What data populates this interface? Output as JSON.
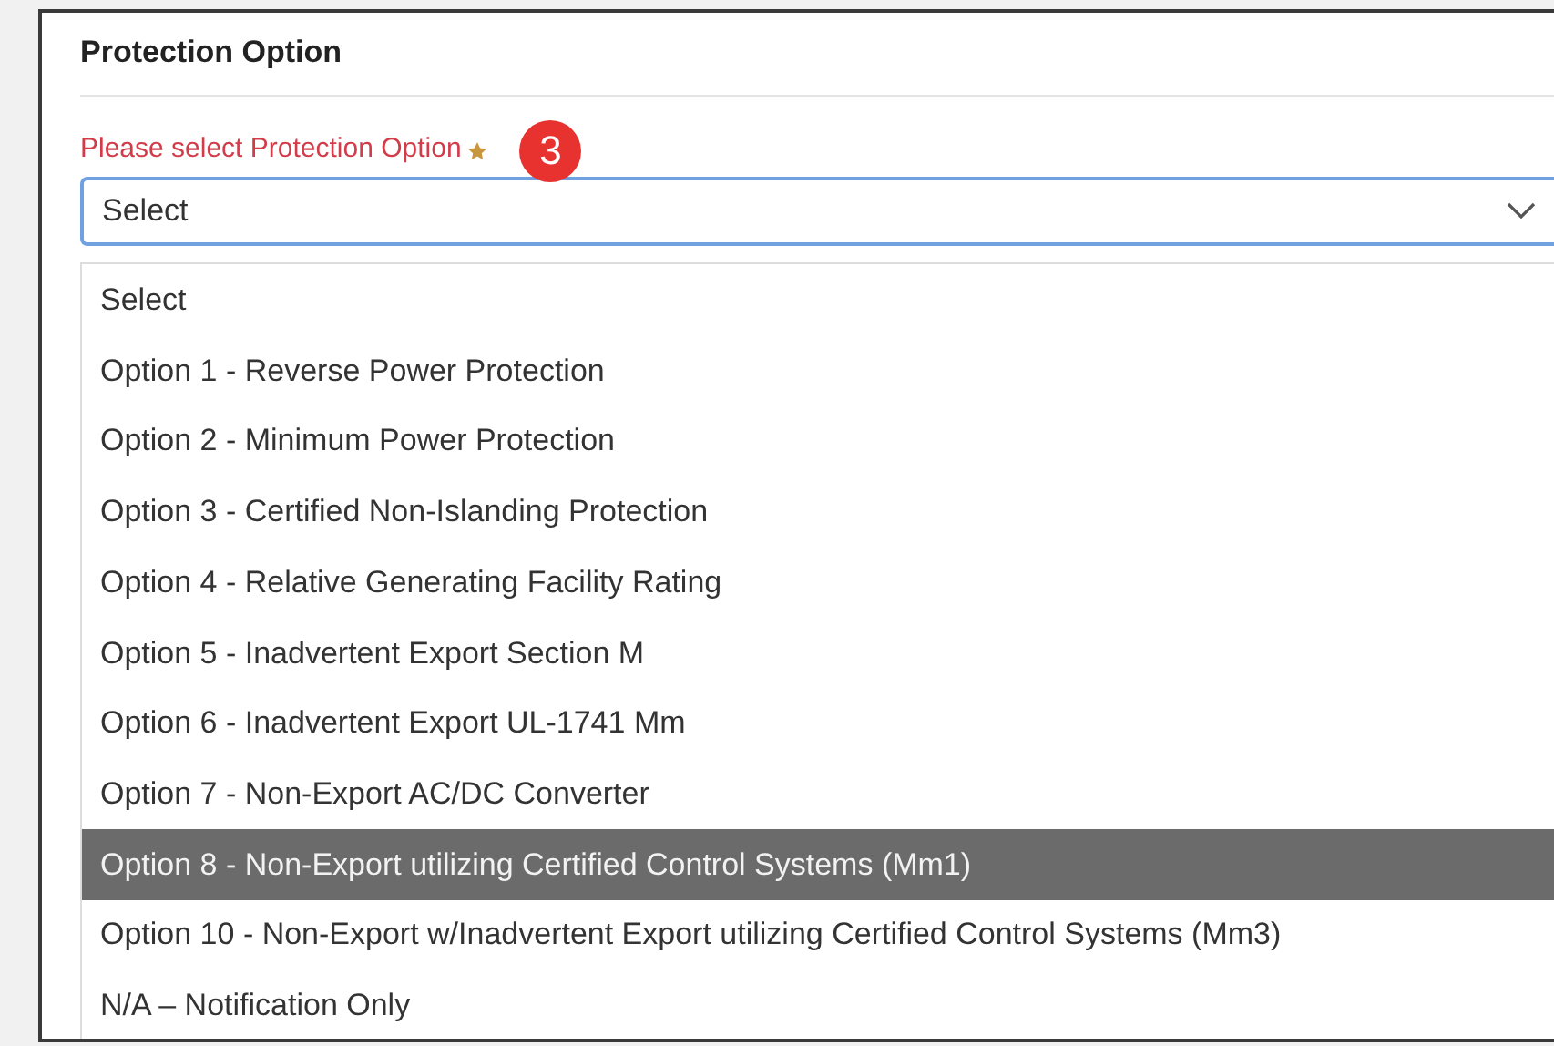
{
  "section": {
    "title": "Protection Option"
  },
  "field": {
    "label": "Please select Protection Option",
    "required": true,
    "step_badge": "3",
    "value": "Select",
    "expanded": true
  },
  "options": [
    {
      "label": "Select",
      "selected": false
    },
    {
      "label": "Option 1 - Reverse Power Protection",
      "selected": false
    },
    {
      "label": "Option 2 - Minimum Power Protection",
      "selected": false
    },
    {
      "label": "Option 3 - Certified Non-Islanding Protection",
      "selected": false
    },
    {
      "label": "Option 4 - Relative Generating Facility Rating",
      "selected": false
    },
    {
      "label": "Option 5 - Inadvertent Export Section M",
      "selected": false
    },
    {
      "label": "Option 6 - Inadvertent Export UL-1741 Mm",
      "selected": false
    },
    {
      "label": "Option 7 - Non-Export AC/DC Converter",
      "selected": false
    },
    {
      "label": "Option 8 - Non-Export utilizing Certified Control Systems (Mm1)",
      "selected": true
    },
    {
      "label": "Option 10 - Non-Export w/Inadvertent Export utilizing Certified Control Systems (Mm3)",
      "selected": false
    },
    {
      "label": "N/A – Notification Only",
      "selected": false
    }
  ]
}
